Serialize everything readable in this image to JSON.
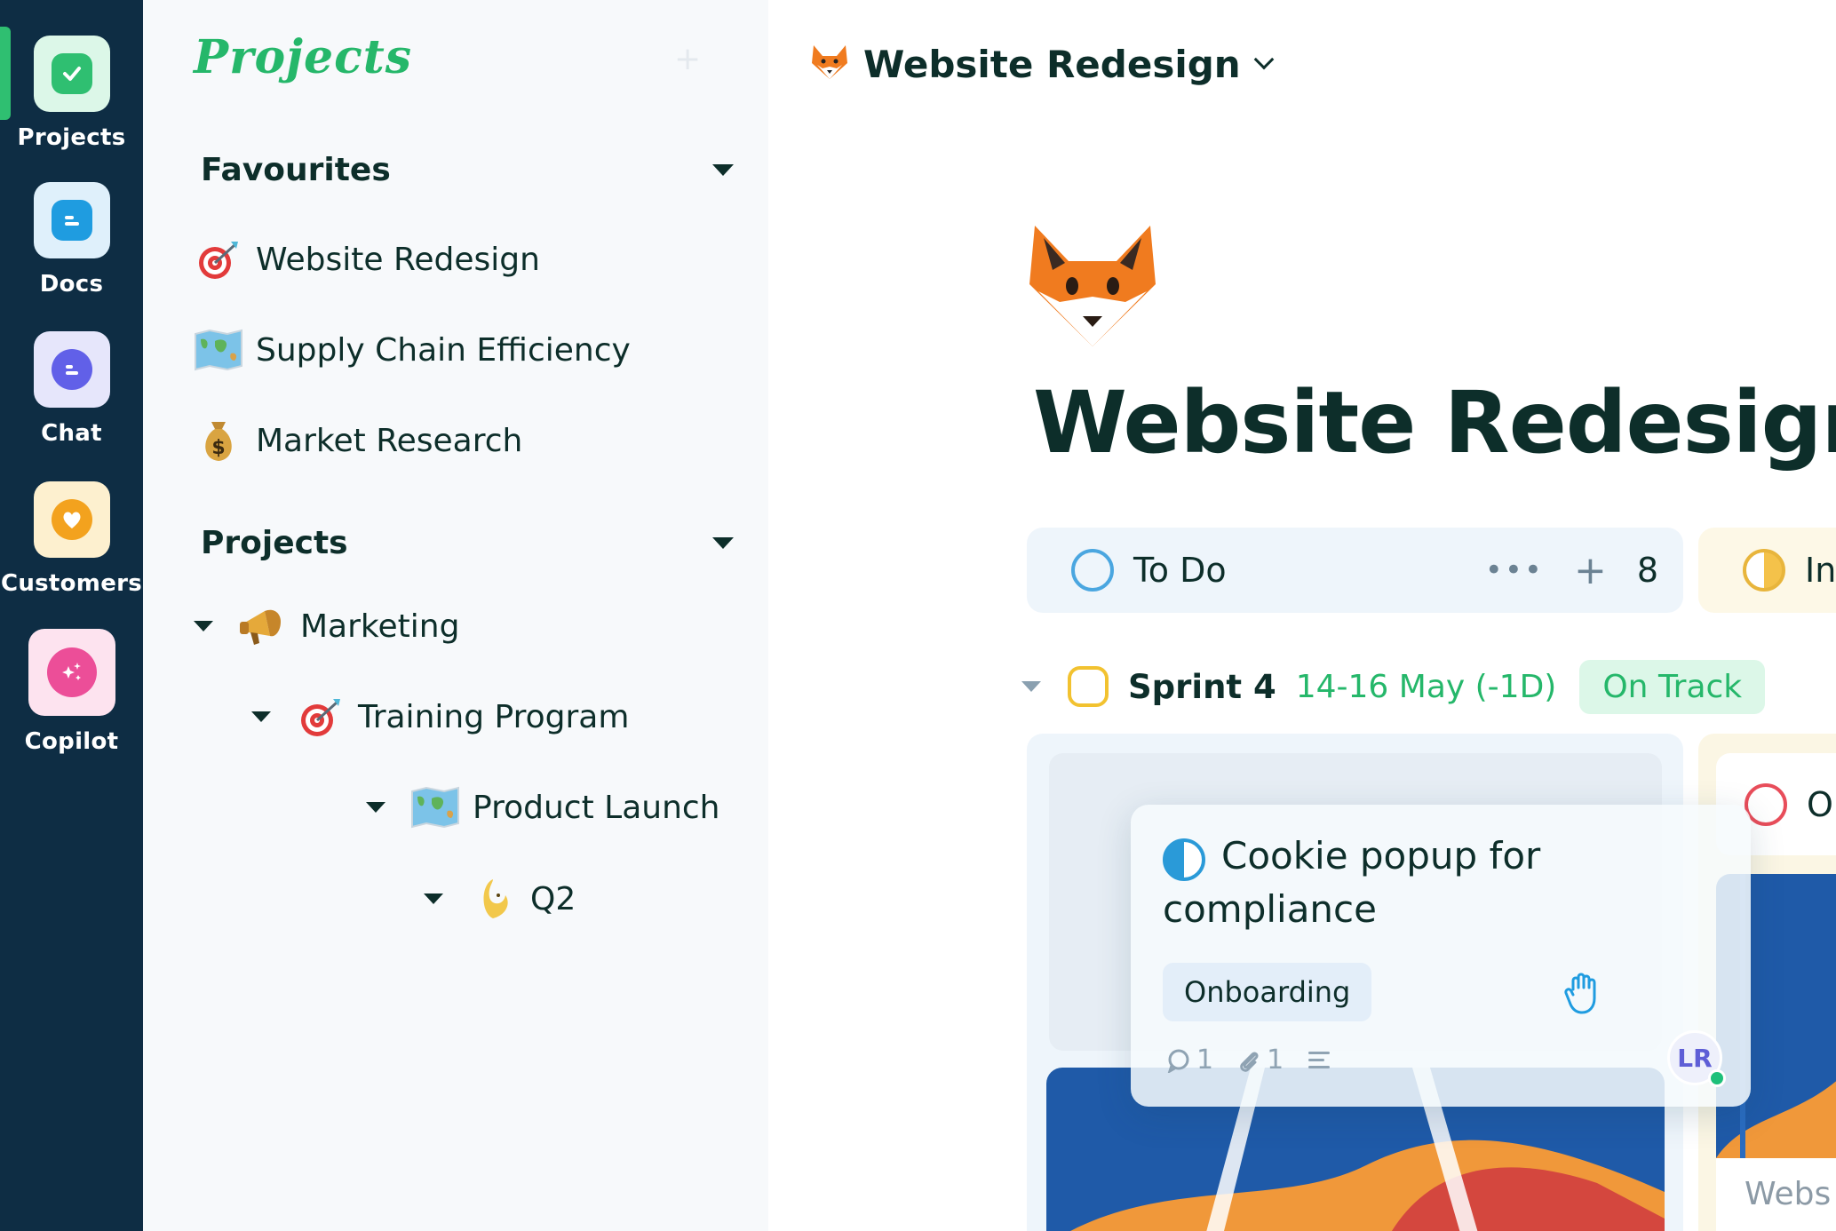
{
  "rail": {
    "items": [
      {
        "label": "Projects",
        "icon": "check-icon",
        "color": "#2fbf71"
      },
      {
        "label": "Docs",
        "icon": "doc-icon",
        "color": "#1f9ce0"
      },
      {
        "label": "Chat",
        "icon": "chat-icon",
        "color": "#6160e8"
      },
      {
        "label": "Customers",
        "icon": "heart-icon",
        "color": "#f3a21e"
      },
      {
        "label": "Copilot",
        "icon": "sparkle-icon",
        "color": "#ec4e98"
      }
    ]
  },
  "sidebar": {
    "title": "Projects",
    "favourites": {
      "heading": "Favourites",
      "items": [
        {
          "label": "Website Redesign",
          "emoji": "target"
        },
        {
          "label": "Supply Chain Efficiency",
          "emoji": "world-map"
        },
        {
          "label": "Market Research",
          "emoji": "money-bag"
        }
      ]
    },
    "projects": {
      "heading": "Projects",
      "tree": [
        {
          "label": "Marketing",
          "emoji": "megaphone"
        },
        {
          "label": "Training Program",
          "emoji": "target"
        },
        {
          "label": "Product Launch",
          "emoji": "world-map"
        },
        {
          "label": "Q2",
          "emoji": "moon"
        }
      ]
    }
  },
  "main": {
    "breadcrumb": "Website Redesign",
    "title": "Website Redesign",
    "columns": [
      {
        "label": "To Do",
        "count": "8",
        "status_color": "#4aa6e0"
      },
      {
        "label": "In",
        "status_color": "#f4c24a"
      }
    ],
    "sprint": {
      "name": "Sprint 4",
      "dates": "14-16 May (-1D)",
      "status": "On Track"
    },
    "card": {
      "title_line1": "Cookie popup for",
      "title_line2": "compliance",
      "tag": "Onboarding",
      "comments": "1",
      "attachments": "1"
    },
    "card2": {
      "label": "O",
      "footer": "Webs"
    },
    "avatar": "LR",
    "colors": {
      "accent": "#25b76a",
      "rail_bg": "#0e2d44",
      "text": "#0d2e2a"
    }
  }
}
